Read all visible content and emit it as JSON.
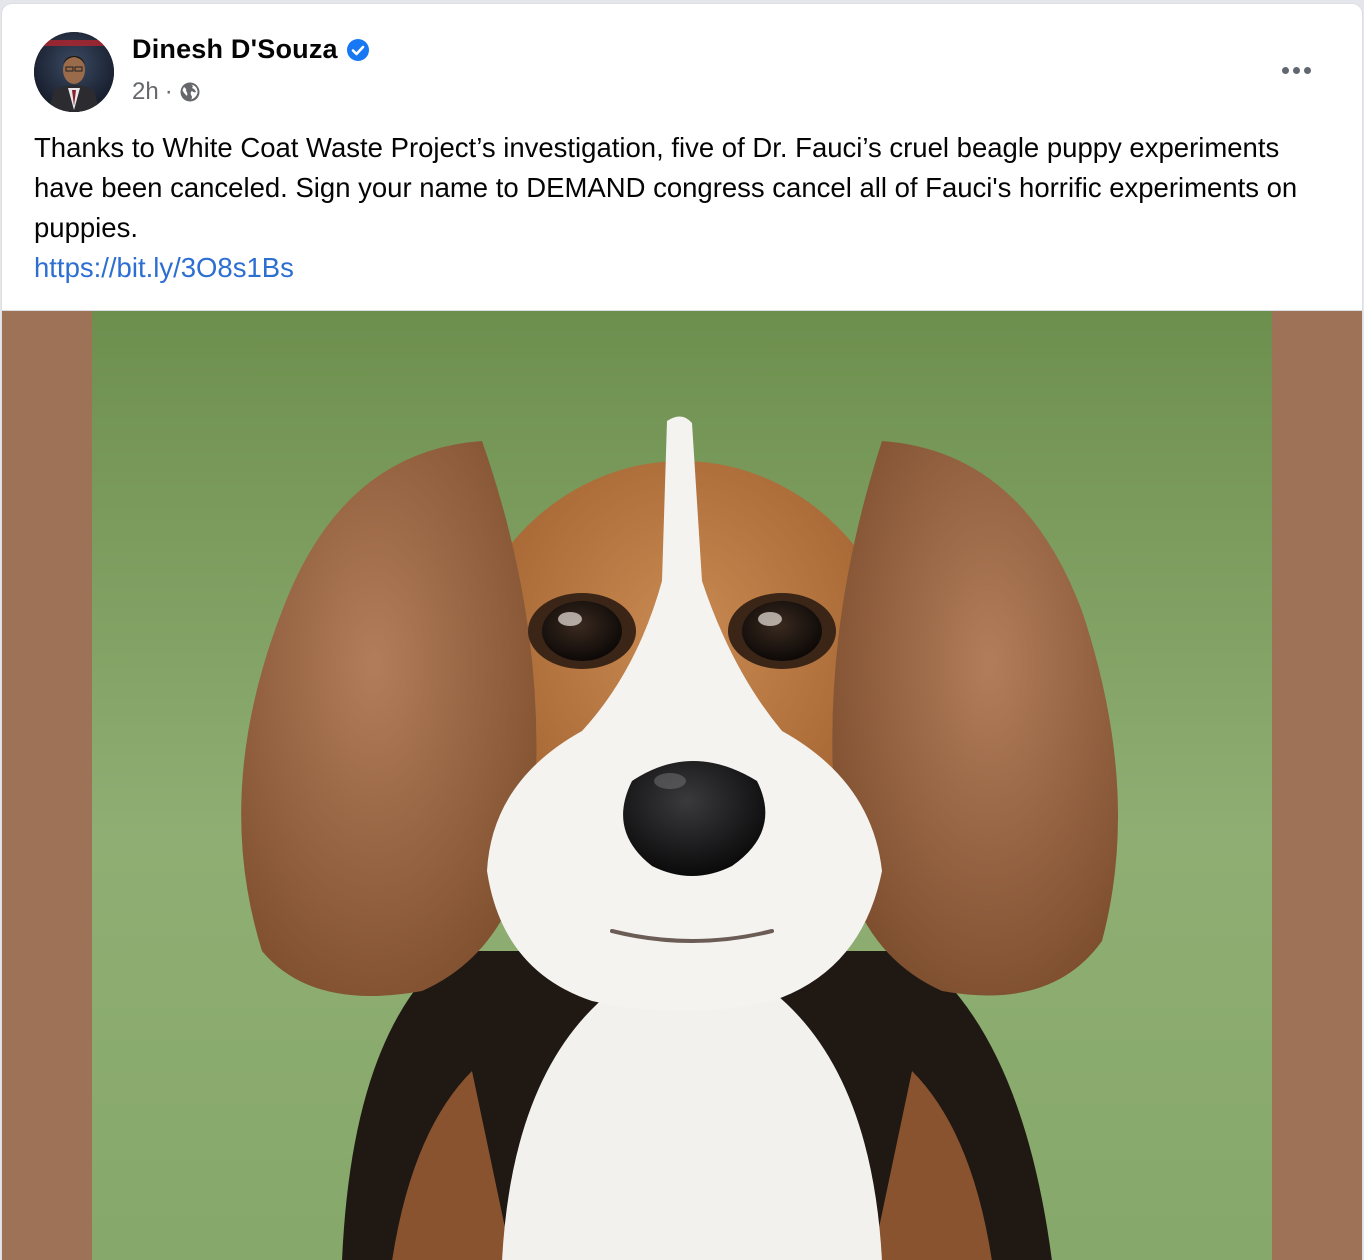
{
  "post": {
    "author": "Dinesh D'Souza",
    "verified_icon": "verified-badge-icon",
    "time": "2h",
    "separator": "·",
    "audience_icon": "globe-icon",
    "more_icon": "more-options-icon",
    "text": "Thanks to White Coat Waste Project’s investigation, five of Dr. Fauci’s cruel beagle puppy experiments have been canceled. Sign your name to DEMAND congress cancel all of Fauci's horrific experiments on puppies.",
    "link": "https://bit.ly/3O8s1Bs",
    "image_letterbox_color": "#9e7257",
    "link_color": "#2d6fd1",
    "verified_color": "#1877f2"
  }
}
